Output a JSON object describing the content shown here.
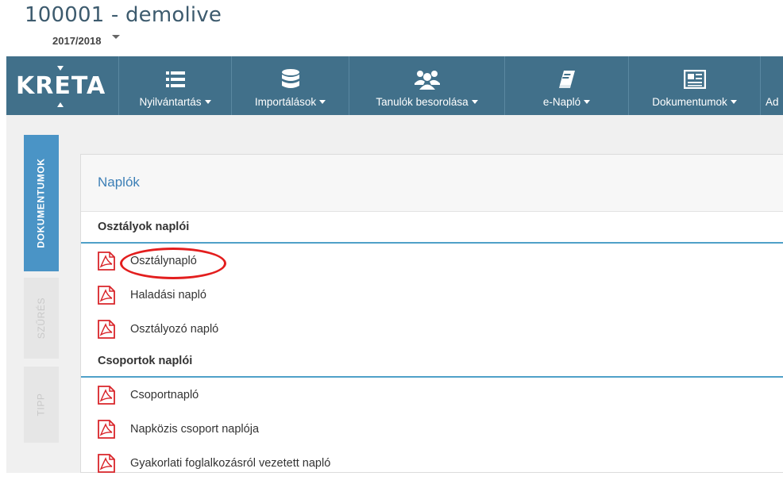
{
  "header": {
    "school_title": "100001 - demolive",
    "school_year": "2017/2018"
  },
  "navbar": {
    "logo_text": "KRETA",
    "items": [
      {
        "label": "Nyilvántartás",
        "icon": "list-icon"
      },
      {
        "label": "Importálások",
        "icon": "database-icon"
      },
      {
        "label": "Tanulók besorolása",
        "icon": "users-icon"
      },
      {
        "label": "e-Napló",
        "icon": "book-icon"
      },
      {
        "label": "Dokumentumok",
        "icon": "newspaper-icon"
      },
      {
        "label": "Ad",
        "icon": ""
      }
    ]
  },
  "side_tabs": {
    "documents": "DOKUMENTUMOK",
    "filter": "SZŰRÉS",
    "tip": "TIPP"
  },
  "panel": {
    "title": "Naplók",
    "sections": [
      {
        "header": "Osztályok naplói",
        "items": [
          "Osztálynapló",
          "Haladási napló",
          "Osztályozó napló"
        ]
      },
      {
        "header": "Csoportok naplói",
        "items": [
          "Csoportnapló",
          "Napközis csoport naplója",
          "Gyakorlati foglalkozásról vezetett napló"
        ]
      }
    ]
  },
  "colors": {
    "navbar": "#41708a",
    "accent_tab": "#4a94c6",
    "panel_title": "#3c7fb6",
    "section_rule": "#4fa0c8",
    "pdf_icon": "#d9252a",
    "highlight": "#e31e1e"
  }
}
